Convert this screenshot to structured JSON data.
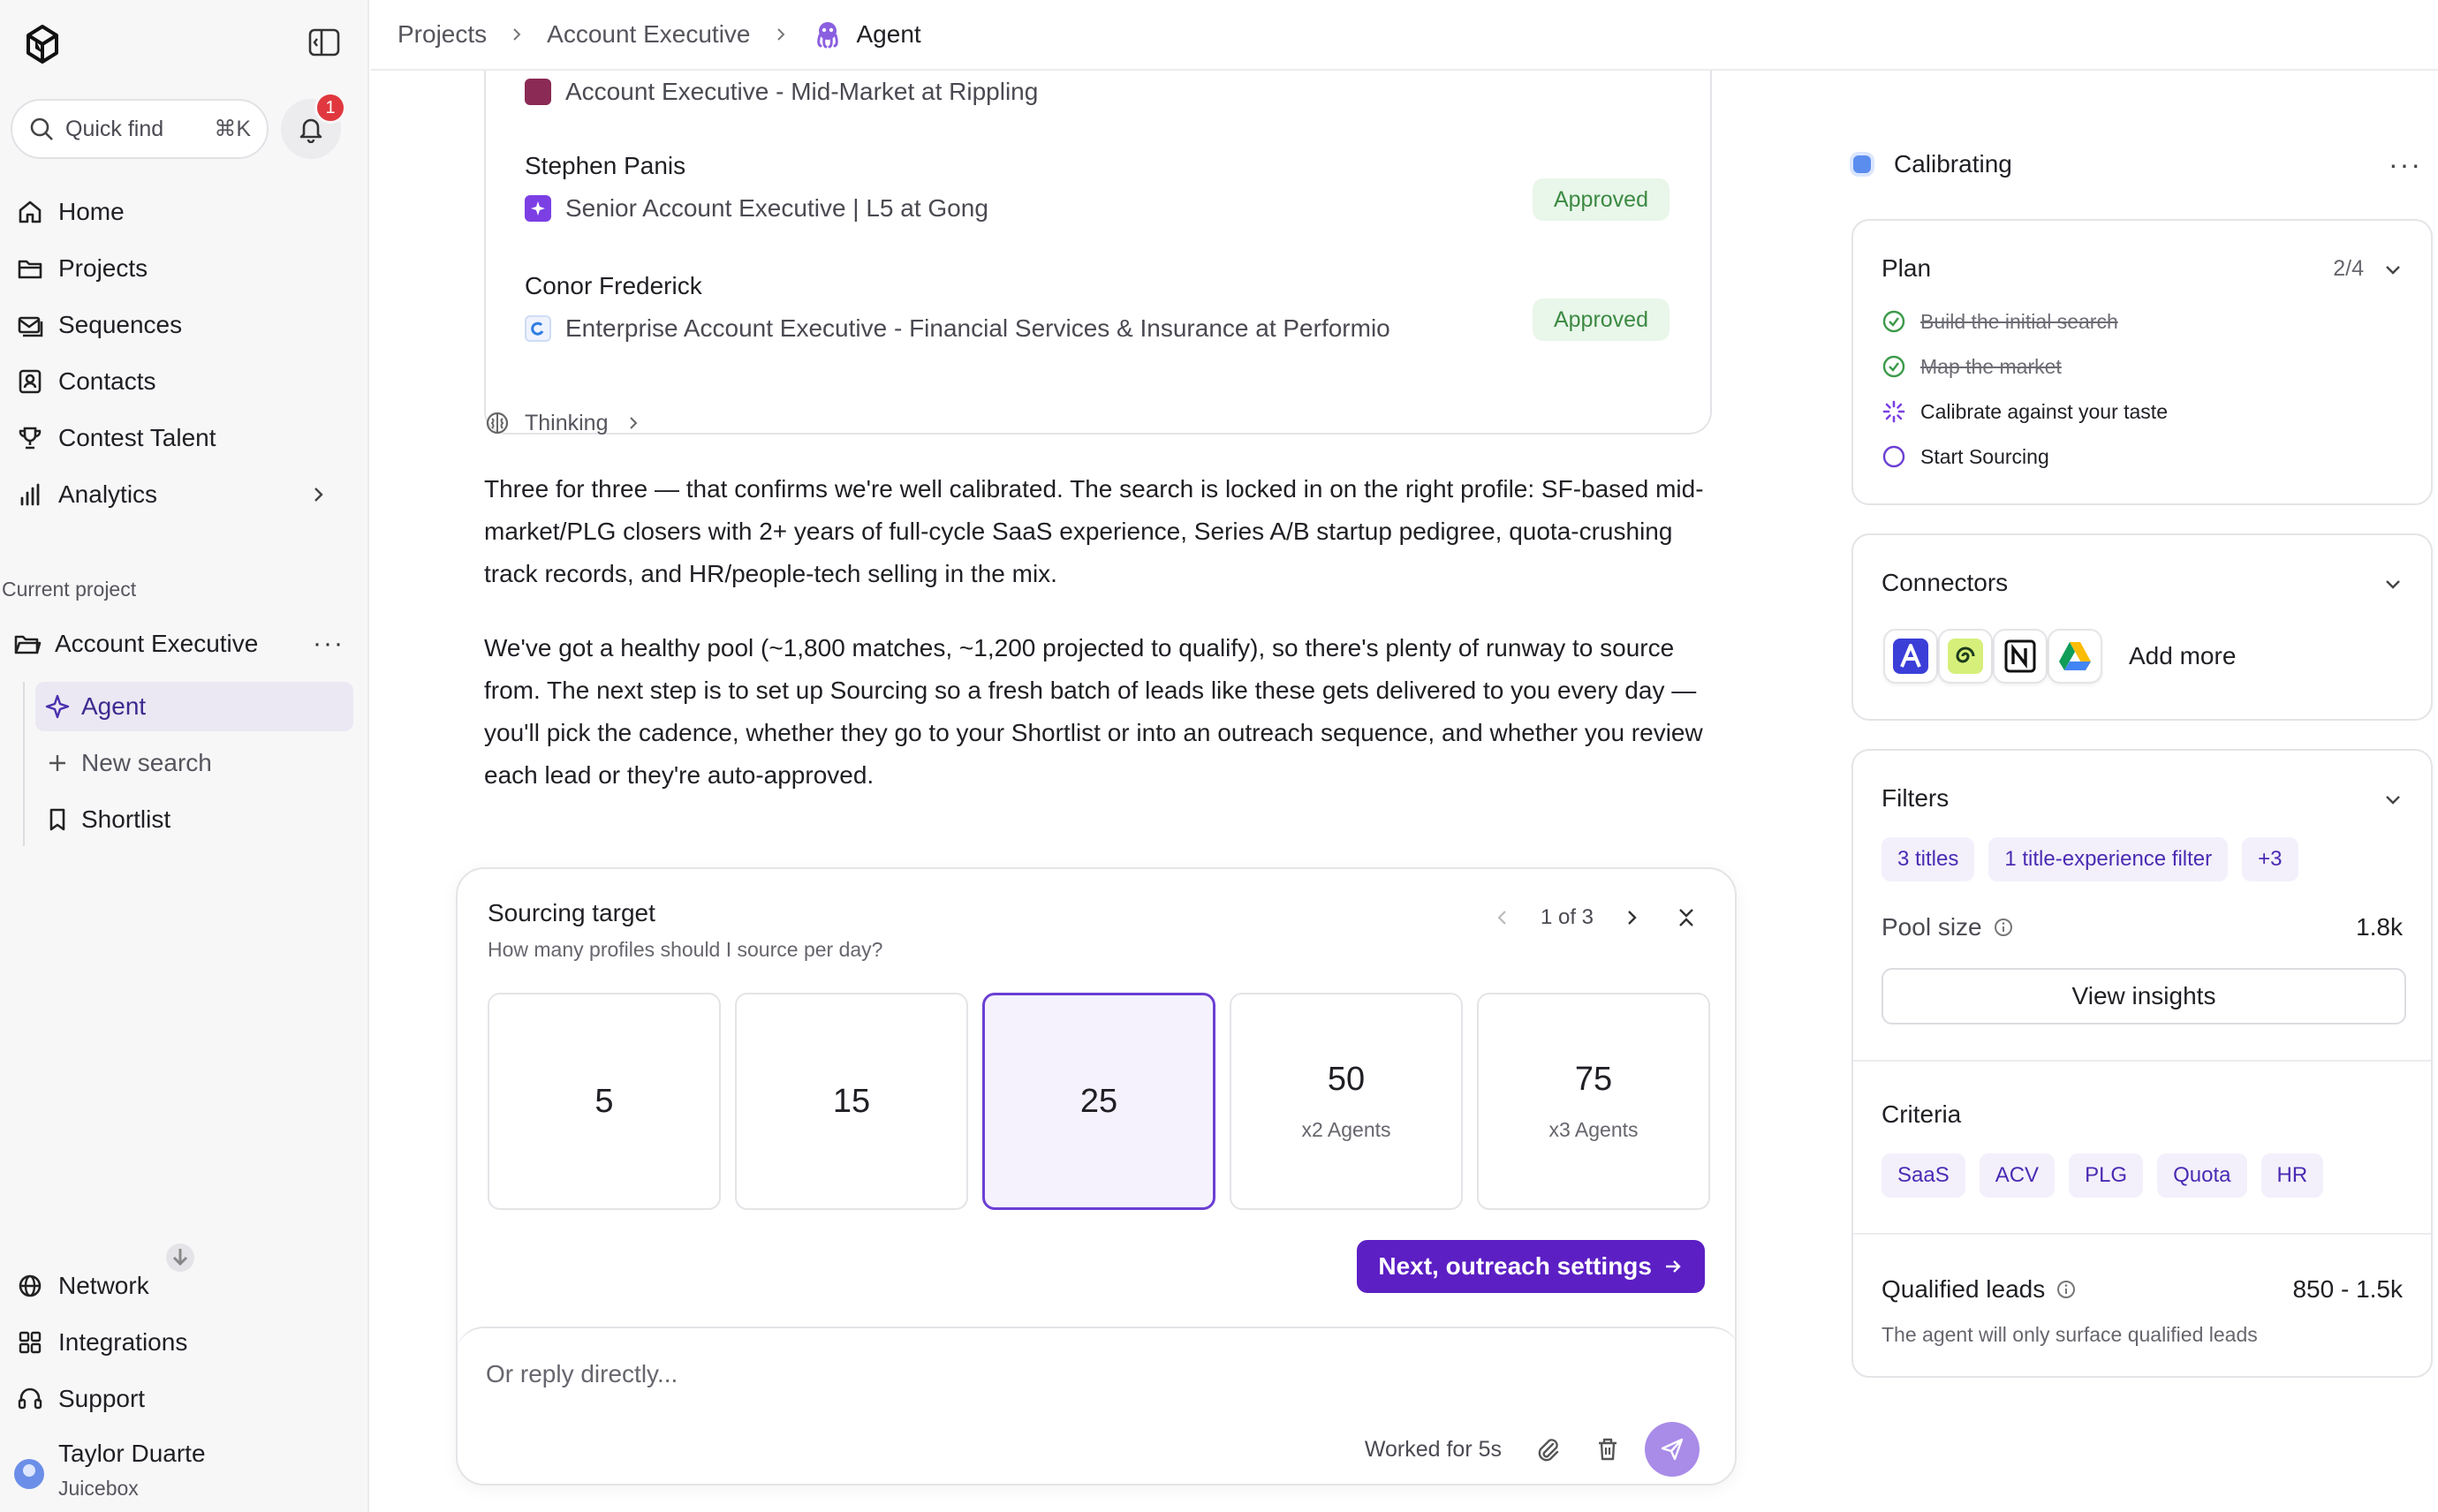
{
  "sidebar": {
    "quick_find": "Quick find",
    "quick_find_kbd": "⌘K",
    "notifications_count": "1",
    "nav": [
      {
        "label": "Home",
        "icon": "home-icon"
      },
      {
        "label": "Projects",
        "icon": "folder-icon"
      },
      {
        "label": "Sequences",
        "icon": "mail-stack-icon"
      },
      {
        "label": "Contacts",
        "icon": "contact-card-icon"
      },
      {
        "label": "Contest Talent",
        "icon": "trophy-icon"
      },
      {
        "label": "Analytics",
        "icon": "bar-chart-icon"
      }
    ],
    "current_project_label": "Current project",
    "current_project": "Account Executive",
    "project_items": [
      {
        "label": "Agent",
        "icon": "sparkle-icon"
      },
      {
        "label": "New search",
        "icon": "plus-icon"
      },
      {
        "label": "Shortlist",
        "icon": "bookmark-icon"
      }
    ],
    "bottom_nav": [
      {
        "label": "Network",
        "icon": "globe-icon"
      },
      {
        "label": "Integrations",
        "icon": "grid-icon"
      },
      {
        "label": "Support",
        "icon": "headset-icon"
      }
    ],
    "user": {
      "name": "Taylor Duarte",
      "org": "Juicebox"
    }
  },
  "breadcrumb": {
    "items": [
      "Projects",
      "Account Executive"
    ],
    "current": "Agent"
  },
  "candidates": {
    "cut_role": "Account Executive - Mid-Market at Rippling",
    "list": [
      {
        "name": "Stephen Panis",
        "role": "Senior Account Executive | L5 at Gong",
        "status": "Approved",
        "logo_color": "#7b3fe4"
      },
      {
        "name": "Conor Frederick",
        "role": "Enterprise Account Executive - Financial Services & Insurance at Performio",
        "status": "Approved",
        "logo_color": "#2f7de1"
      }
    ]
  },
  "thinking_label": "Thinking",
  "message": {
    "p1": "Three for three — that confirms we're well calibrated. The search is locked in on the right profile: SF-based mid-market/PLG closers with 2+ years of full-cycle SaaS experience, Series A/B startup pedigree, quota-crushing track records, and HR/people-tech selling in the mix.",
    "p2": "We've got a healthy pool (~1,800 matches, ~1,200 projected to qualify), so there's plenty of runway to source from. The next step is to set up Sourcing so a fresh batch of leads like these gets delivered to you every day — you'll pick the cadence, whether they go to your Shortlist or into an outreach sequence, and whether you review each lead or they're auto-approved."
  },
  "sourcing": {
    "title": "Sourcing target",
    "subtitle": "How many profiles should I source per day?",
    "pager": "1 of 3",
    "options": [
      {
        "value": "5",
        "sub": ""
      },
      {
        "value": "15",
        "sub": ""
      },
      {
        "value": "25",
        "sub": ""
      },
      {
        "value": "50",
        "sub": "x2 Agents"
      },
      {
        "value": "75",
        "sub": "x3 Agents"
      }
    ],
    "selected_value": "25",
    "next_label": "Next, outreach settings",
    "reply_placeholder": "Or reply directly...",
    "worked_for": "Worked for 5s"
  },
  "right_panel": {
    "status": "Calibrating",
    "plan": {
      "title": "Plan",
      "count": "2/4",
      "items": [
        {
          "label": "Build the initial search",
          "state": "done"
        },
        {
          "label": "Map the market",
          "state": "done"
        },
        {
          "label": "Calibrate against your taste",
          "state": "active"
        },
        {
          "label": "Start Sourcing",
          "state": "pending"
        }
      ]
    },
    "connectors": {
      "title": "Connectors",
      "add_more": "Add more",
      "icons": [
        "apollo-icon",
        "greenhouse-icon",
        "notion-icon",
        "google-drive-icon"
      ]
    },
    "filters": {
      "title": "Filters",
      "chips": [
        "3 titles",
        "1 title-experience filter",
        "+3"
      ],
      "pool_label": "Pool size",
      "pool_value": "1.8k",
      "insights_label": "View insights"
    },
    "criteria": {
      "title": "Criteria",
      "chips": [
        "SaaS",
        "ACV",
        "PLG",
        "Quota",
        "HR"
      ]
    },
    "qualified": {
      "label": "Qualified leads",
      "value": "850 - 1.5k",
      "note": "The agent will only surface qualified leads"
    }
  },
  "colors": {
    "accent": "#5c1fc4",
    "approved_bg": "#e9f6ea",
    "approved_text": "#3c8a43",
    "status_dot": "#5b8def"
  }
}
